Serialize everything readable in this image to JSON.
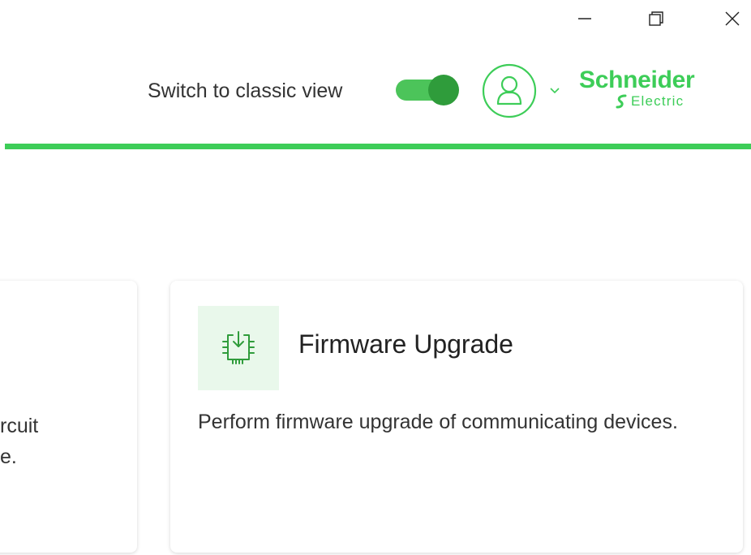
{
  "window": {
    "controls": [
      "minimize-icon",
      "restore-icon",
      "close-icon"
    ]
  },
  "header": {
    "classic_view_label": "Switch to classic view",
    "classic_view_on": true,
    "avatar_icon": "user-icon",
    "chevron_icon": "chevron-down-icon",
    "logo_primary": "Schneider",
    "logo_secondary": "Electric"
  },
  "cards": {
    "left_partial": {
      "desc_line1": "rcuit",
      "desc_line2": "e."
    },
    "firmware": {
      "icon": "chip-download-icon",
      "title": "Firmware Upgrade",
      "description": "Perform firmware upgrade of communicating devices."
    }
  },
  "colors": {
    "brand_green": "#3dcd58",
    "toggle_track": "#4cc45a",
    "toggle_knob": "#2f9c3b",
    "icon_bg": "#e9f8eb",
    "icon_stroke": "#2f9c3b"
  }
}
